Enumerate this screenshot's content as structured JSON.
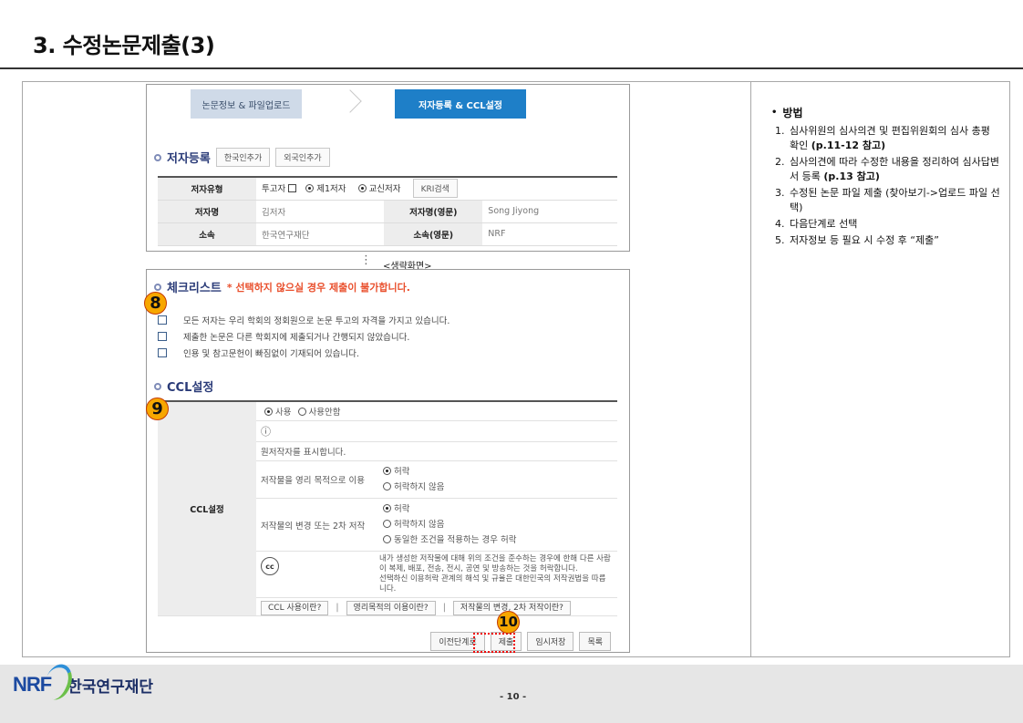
{
  "slide": {
    "title": "3. 수정논문제출(3)",
    "page_number": "- 10 -"
  },
  "steps": {
    "step1": "논문정보 & 파일업로드",
    "step2": "저자등록 & CCL설정"
  },
  "author_section": {
    "title": "저자등록",
    "btn_domestic": "한국인추가",
    "btn_foreign": "외국인추가",
    "type_label": "저자유형",
    "type_contributor": "투고자",
    "type_first": "제1저자",
    "type_corr": "교신저자",
    "kri_btn": "KRI검색",
    "name_label": "저자명",
    "name_value": "김저자",
    "name_en_label": "저자명(영문)",
    "name_en_value": "Song Jiyong",
    "aff_label": "소속",
    "aff_value": "한국연구재단",
    "aff_en_label": "소속(영문)",
    "aff_en_value": "NRF"
  },
  "omitted": "<생략화면>",
  "checklist": {
    "title": "체크리스트",
    "subtitle": "* 선택하지 않으실 경우 제출이 불가합니다.",
    "items": [
      "모든 저자는 우리 학회의 정회원으로 논문 투고의 자격을 가지고 있습니다.",
      "제출한 논문은 다른 학회지에 제출되거나 간행되지 않았습니다.",
      "인용 및 참고문헌이 빠짐없이 기재되어 있습니다."
    ]
  },
  "ccl": {
    "title": "CCL설정",
    "row_label": "CCL설정",
    "use": "사용",
    "not_use": "사용안함",
    "attr_icon": "ⓘ",
    "attribution": "원저작자를 표시합니다.",
    "commercial_label": "저작물을 영리 목적으로 이용",
    "allow": "허락",
    "disallow": "허락하지 않음",
    "derivative_label": "저작물의 변경 또는 2차 저작",
    "same_cond": "동일한 조건을 적용하는 경우 허락",
    "cc_logo": "cc",
    "notice1": "내가 생성한 저작물에 대해 위의 조건을 준수하는 경우에 한해 다른 사람이 복제, 배포, 전송, 전시, 공연 및 방송하는 것을 허락합니다.",
    "notice2": "선택하신 이용허락 관계의 해석 및 규율은 대한민국의 저작권법을 따릅니다.",
    "link1": "CCL 사용이란?",
    "link2": "영리목적의 이용이란?",
    "link3": "저작물의 변경, 2차 저작이란?",
    "separator": "|"
  },
  "actions": {
    "prev": "이전단계로",
    "submit": "제출",
    "save": "임시저장",
    "list": "목록"
  },
  "badges": {
    "b8": "8",
    "b9": "9",
    "b10": "10"
  },
  "instructions": {
    "heading": "방법",
    "items": [
      {
        "n": "1.",
        "text": "심사위원의 심사의견 및 편집위원회의 심사 총평 확인",
        "ref": "(p.11-12 참고)"
      },
      {
        "n": "2.",
        "text": "심사의견에 따라 수정한 내용을 정리하여 심사답변서 등록",
        "ref": "(p.13 참고)"
      },
      {
        "n": "3.",
        "text": "수정된 논문 파일 제출 (찾아보기->업로드 파일 선택)",
        "ref": ""
      },
      {
        "n": "4.",
        "text": "다음단계로 선택",
        "ref": ""
      },
      {
        "n": "5.",
        "text": "저자정보 등 필요 시 수정 후 “제출”",
        "ref": ""
      }
    ]
  },
  "footer": {
    "logo": "NRF",
    "org": "한국연구재단"
  },
  "colors": {
    "badge": "#f7a700",
    "active_step": "#1e7fc8",
    "warning": "#e94f2c",
    "highlight": "#e00000"
  }
}
